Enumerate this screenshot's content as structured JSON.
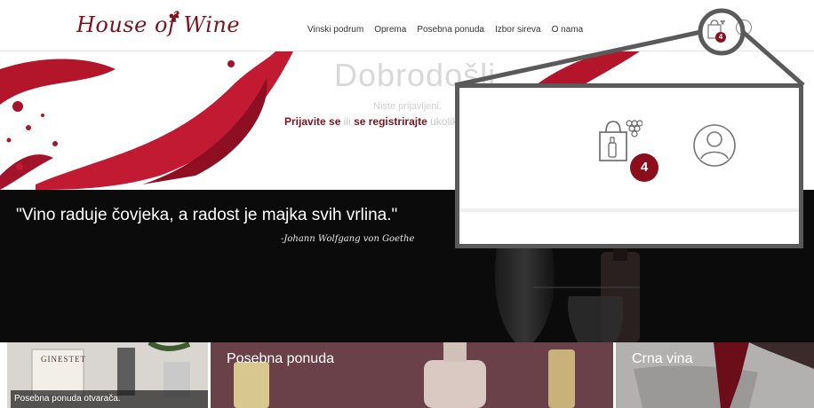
{
  "header": {
    "logo_text": "House of Wine",
    "nav": [
      "Vinski podrum",
      "Oprema",
      "Posebna ponuda",
      "Izbor sireva",
      "O nama"
    ],
    "cart_count": "4"
  },
  "hero": {
    "title": "Dobrodošli",
    "subtitle": "Niste prijavljeni.",
    "login_link": "Prijavite se",
    "or_text": "ili",
    "register_link": "se registrirajte",
    "tail_text": "ukoliko"
  },
  "quote": {
    "text": "\"Vino raduje čovjeka, a radost je majka svih vrlina.\"",
    "author": "-Johann Wolfgang von Goethe"
  },
  "tiles": {
    "tile1_caption": "Posebna ponuda otvarača.",
    "tile1_bottle_label": "GINESTET",
    "tile2_title": "Posebna ponuda",
    "tile3_title": "Crna vina"
  },
  "zoom": {
    "badge": "4"
  },
  "colors": {
    "brand": "#7a1420",
    "badge": "#8c0e1c",
    "band": "#0b0b0b"
  },
  "icons": [
    "grape-icon",
    "shopping-bag-icon",
    "user-icon"
  ]
}
